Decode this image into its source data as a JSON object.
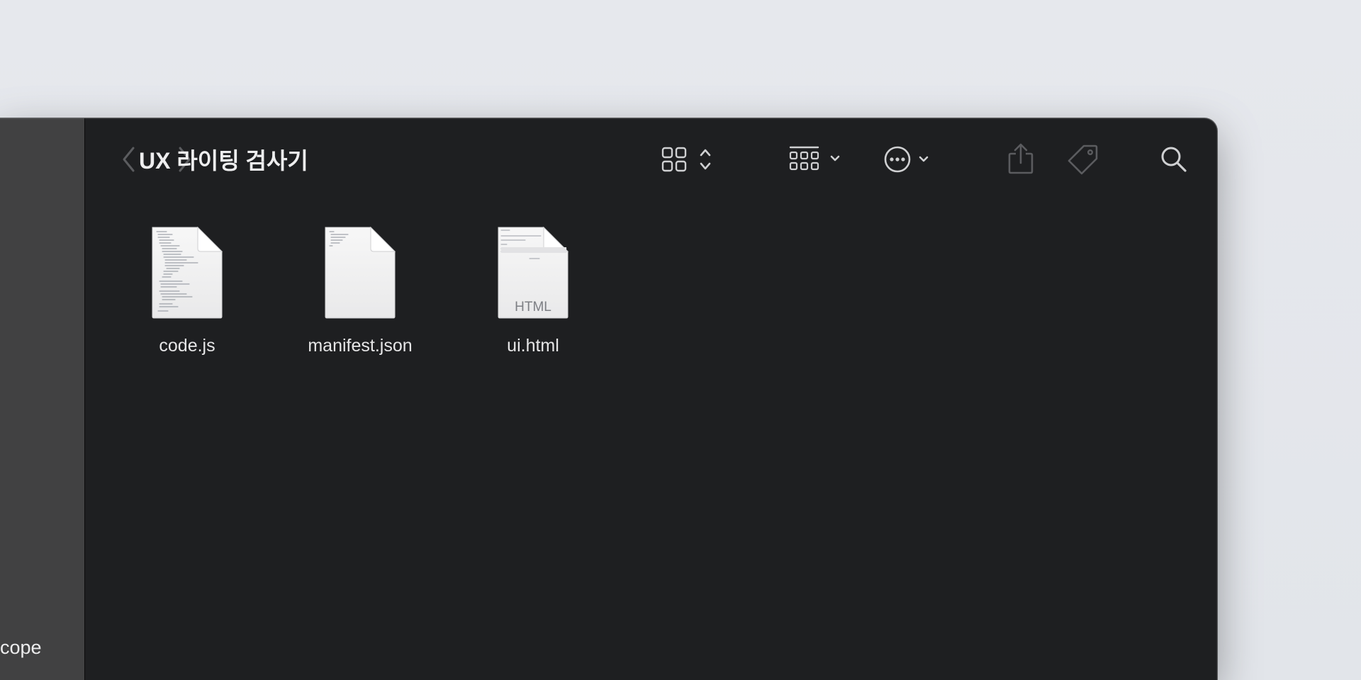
{
  "window": {
    "title": "UX 라이팅 검사기"
  },
  "sidebar": {
    "items": [
      {
        "label": "cope"
      }
    ]
  },
  "toolbar": {
    "back_icon": "chevron-left-icon",
    "forward_icon": "chevron-right-icon",
    "view_icon": "grid-icon",
    "group_icon": "group-icon",
    "action_icon": "ellipsis-circle-icon",
    "share_icon": "share-icon",
    "tag_icon": "tag-icon",
    "search_icon": "search-icon"
  },
  "files": [
    {
      "name": "code.js",
      "kind": "js"
    },
    {
      "name": "manifest.json",
      "kind": "json"
    },
    {
      "name": "ui.html",
      "kind": "html",
      "badge": "HTML"
    }
  ],
  "colors": {
    "window_bg": "#1e1f21",
    "sidebar_bg": "#414142",
    "desktop_bg": "#e3e6eb",
    "text": "#eeeeef",
    "icon_disabled": "#5b5c5f",
    "icon_enabled": "#cfd0d2"
  }
}
